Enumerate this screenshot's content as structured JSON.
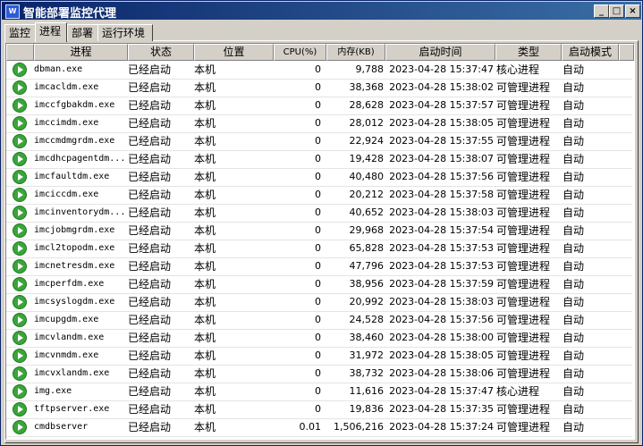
{
  "window": {
    "title": "智能部署监控代理",
    "icon_text": "W"
  },
  "tabs": [
    {
      "label": "监控"
    },
    {
      "label": "进程",
      "active": true
    },
    {
      "label": "部署"
    },
    {
      "label": "运行环境"
    }
  ],
  "table": {
    "headers": {
      "process": "进程",
      "status": "状态",
      "location": "位置",
      "cpu": "CPU(%)",
      "memory": "内存(KB)",
      "start_time": "启动时间",
      "type": "类型",
      "start_mode": "启动模式"
    },
    "rows": [
      {
        "process": "dbman.exe",
        "status": "已经启动",
        "location": "本机",
        "cpu": "0",
        "memory": "9,788",
        "start_time": "2023-04-28 15:37:47",
        "type": "核心进程",
        "start_mode": "自动"
      },
      {
        "process": "imcacldm.exe",
        "status": "已经启动",
        "location": "本机",
        "cpu": "0",
        "memory": "38,368",
        "start_time": "2023-04-28 15:38:02",
        "type": "可管理进程",
        "start_mode": "自动"
      },
      {
        "process": "imccfgbakdm.exe",
        "status": "已经启动",
        "location": "本机",
        "cpu": "0",
        "memory": "28,628",
        "start_time": "2023-04-28 15:37:57",
        "type": "可管理进程",
        "start_mode": "自动"
      },
      {
        "process": "imccimdm.exe",
        "status": "已经启动",
        "location": "本机",
        "cpu": "0",
        "memory": "28,012",
        "start_time": "2023-04-28 15:38:05",
        "type": "可管理进程",
        "start_mode": "自动"
      },
      {
        "process": "imccmdmgrdm.exe",
        "status": "已经启动",
        "location": "本机",
        "cpu": "0",
        "memory": "22,924",
        "start_time": "2023-04-28 15:37:55",
        "type": "可管理进程",
        "start_mode": "自动"
      },
      {
        "process": "imcdhcpagentdm...",
        "status": "已经启动",
        "location": "本机",
        "cpu": "0",
        "memory": "19,428",
        "start_time": "2023-04-28 15:38:07",
        "type": "可管理进程",
        "start_mode": "自动"
      },
      {
        "process": "imcfaultdm.exe",
        "status": "已经启动",
        "location": "本机",
        "cpu": "0",
        "memory": "40,480",
        "start_time": "2023-04-28 15:37:56",
        "type": "可管理进程",
        "start_mode": "自动"
      },
      {
        "process": "imciccdm.exe",
        "status": "已经启动",
        "location": "本机",
        "cpu": "0",
        "memory": "20,212",
        "start_time": "2023-04-28 15:37:58",
        "type": "可管理进程",
        "start_mode": "自动"
      },
      {
        "process": "imcinventorydm...",
        "status": "已经启动",
        "location": "本机",
        "cpu": "0",
        "memory": "40,652",
        "start_time": "2023-04-28 15:38:03",
        "type": "可管理进程",
        "start_mode": "自动"
      },
      {
        "process": "imcjobmgrdm.exe",
        "status": "已经启动",
        "location": "本机",
        "cpu": "0",
        "memory": "29,968",
        "start_time": "2023-04-28 15:37:54",
        "type": "可管理进程",
        "start_mode": "自动"
      },
      {
        "process": "imcl2topodm.exe",
        "status": "已经启动",
        "location": "本机",
        "cpu": "0",
        "memory": "65,828",
        "start_time": "2023-04-28 15:37:53",
        "type": "可管理进程",
        "start_mode": "自动"
      },
      {
        "process": "imcnetresdm.exe",
        "status": "已经启动",
        "location": "本机",
        "cpu": "0",
        "memory": "47,796",
        "start_time": "2023-04-28 15:37:53",
        "type": "可管理进程",
        "start_mode": "自动"
      },
      {
        "process": "imcperfdm.exe",
        "status": "已经启动",
        "location": "本机",
        "cpu": "0",
        "memory": "38,956",
        "start_time": "2023-04-28 15:37:59",
        "type": "可管理进程",
        "start_mode": "自动"
      },
      {
        "process": "imcsyslogdm.exe",
        "status": "已经启动",
        "location": "本机",
        "cpu": "0",
        "memory": "20,992",
        "start_time": "2023-04-28 15:38:03",
        "type": "可管理进程",
        "start_mode": "自动"
      },
      {
        "process": "imcupgdm.exe",
        "status": "已经启动",
        "location": "本机",
        "cpu": "0",
        "memory": "24,528",
        "start_time": "2023-04-28 15:37:56",
        "type": "可管理进程",
        "start_mode": "自动"
      },
      {
        "process": "imcvlandm.exe",
        "status": "已经启动",
        "location": "本机",
        "cpu": "0",
        "memory": "38,460",
        "start_time": "2023-04-28 15:38:00",
        "type": "可管理进程",
        "start_mode": "自动"
      },
      {
        "process": "imcvnmdm.exe",
        "status": "已经启动",
        "location": "本机",
        "cpu": "0",
        "memory": "31,972",
        "start_time": "2023-04-28 15:38:05",
        "type": "可管理进程",
        "start_mode": "自动"
      },
      {
        "process": "imcvxlandm.exe",
        "status": "已经启动",
        "location": "本机",
        "cpu": "0",
        "memory": "38,732",
        "start_time": "2023-04-28 15:38:06",
        "type": "可管理进程",
        "start_mode": "自动"
      },
      {
        "process": "img.exe",
        "status": "已经启动",
        "location": "本机",
        "cpu": "0",
        "memory": "11,616",
        "start_time": "2023-04-28 15:37:47",
        "type": "核心进程",
        "start_mode": "自动"
      },
      {
        "process": "tftpserver.exe",
        "status": "已经启动",
        "location": "本机",
        "cpu": "0",
        "memory": "19,836",
        "start_time": "2023-04-28 15:37:35",
        "type": "可管理进程",
        "start_mode": "自动"
      },
      {
        "process": "cmdbserver",
        "status": "已经启动",
        "location": "本机",
        "cpu": "0.01",
        "memory": "1,506,216",
        "start_time": "2023-04-28 15:37:24",
        "type": "可管理进程",
        "start_mode": "自动"
      }
    ]
  }
}
